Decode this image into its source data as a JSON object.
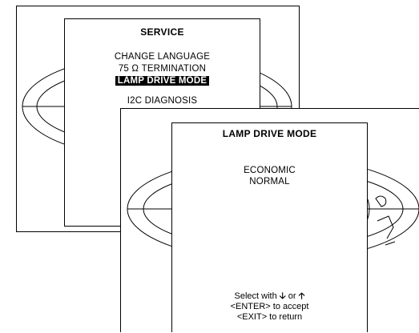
{
  "service_menu": {
    "title": "SERVICE",
    "items": [
      "CHANGE LANGUAGE",
      "75 Ω TERMINATION",
      "LAMP DRIVE MODE",
      "I2C DIAGNOSIS"
    ],
    "selected_index": 2
  },
  "lamp_drive_menu": {
    "title": "LAMP DRIVE MODE",
    "options": [
      "ECONOMIC",
      "NORMAL"
    ],
    "hint_select_prefix": "Select with",
    "hint_down_arrow": "🡣",
    "hint_or": "or",
    "hint_up_arrow": "🡡",
    "hint_enter": "<ENTER> to accept",
    "hint_exit": "<EXIT> to return"
  },
  "icons": [
    "globe-background-icon",
    "arrow-down-icon",
    "arrow-up-icon"
  ]
}
